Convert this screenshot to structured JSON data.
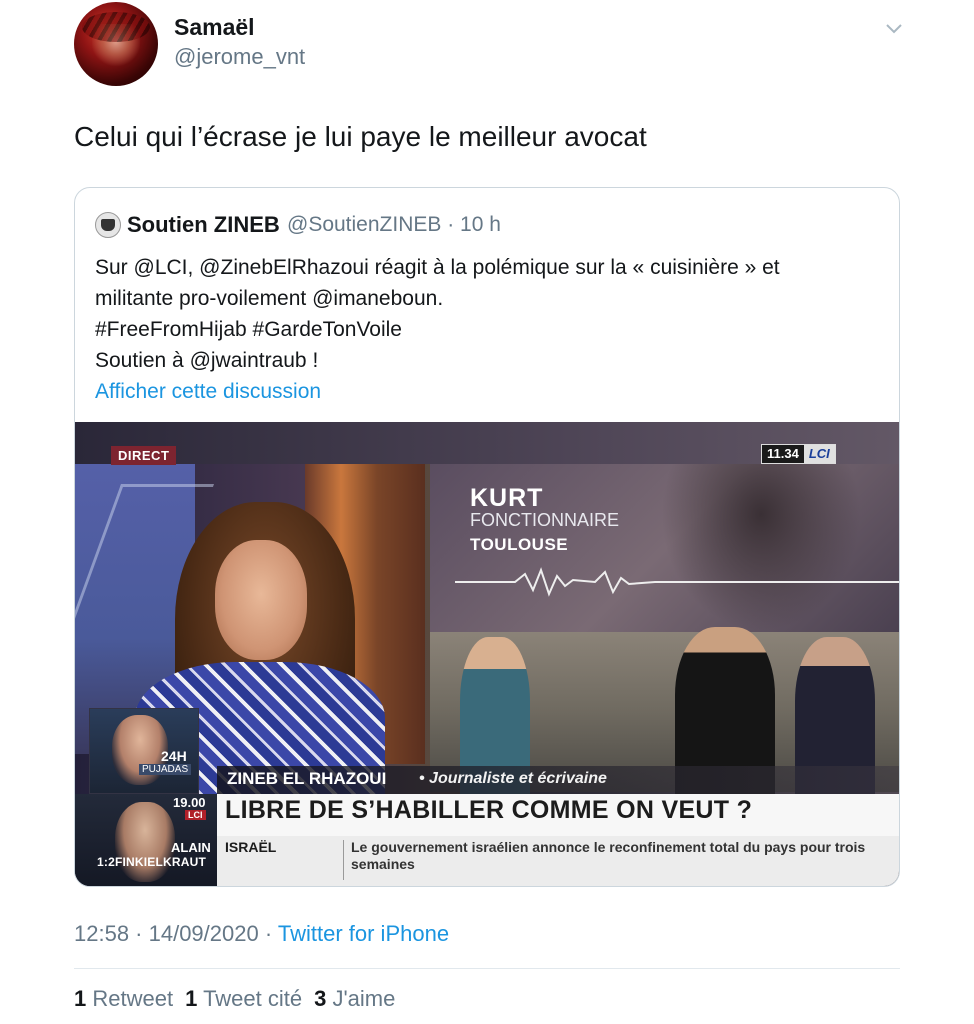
{
  "author": {
    "display_name": "Samaël",
    "handle": "@jerome_vnt"
  },
  "tweet_text": "Celui qui l’écrase je lui paye le meilleur avocat",
  "quoted_tweet": {
    "display_name": "Soutien ZINEB",
    "handle_time": "@SoutienZINEB · 10 h",
    "lines": [
      "Sur @LCI, @ZinebElRhazoui réagit à la polémique sur la « cuisinière » et",
      "militante pro-voilement @imaneboun.",
      "#FreeFromHijab #GardeTonVoile",
      "Soutien à @jwaintraub !"
    ],
    "thread_link": "Afficher cette discussion",
    "video": {
      "direct_badge": "DIRECT",
      "clock": "11.34",
      "channel": "LCI",
      "guest_name": "KURT",
      "guest_job": "FONCTIONNAIRE",
      "guest_city": "TOULOUSE",
      "show_24h": "24H",
      "show_host": "PUJADAS",
      "speaker_name": "ZINEB EL RHAZOUI",
      "speaker_role": "• Journaliste et écrivaine",
      "headline": "LIBRE DE S’HABILLER COMME ON VEUT ?",
      "ticker_category": "ISRAËL",
      "ticker_text": "Le gouvernement israélien annonce le reconfinement total du pays pour trois semaines",
      "next_time": "19.00",
      "next_channel": "LCI",
      "next_guest_first": "ALAIN",
      "next_guest_last": "1:2FINKIELKRAUT"
    }
  },
  "meta": {
    "time_date": "12:58 · 14/09/2020 · ",
    "source": "Twitter for iPhone"
  },
  "stats": {
    "retweets_count": "1",
    "retweets_label": "Retweet",
    "quotes_count": "1",
    "quotes_label": "Tweet cité",
    "likes_count": "3",
    "likes_label": "J'aime"
  }
}
